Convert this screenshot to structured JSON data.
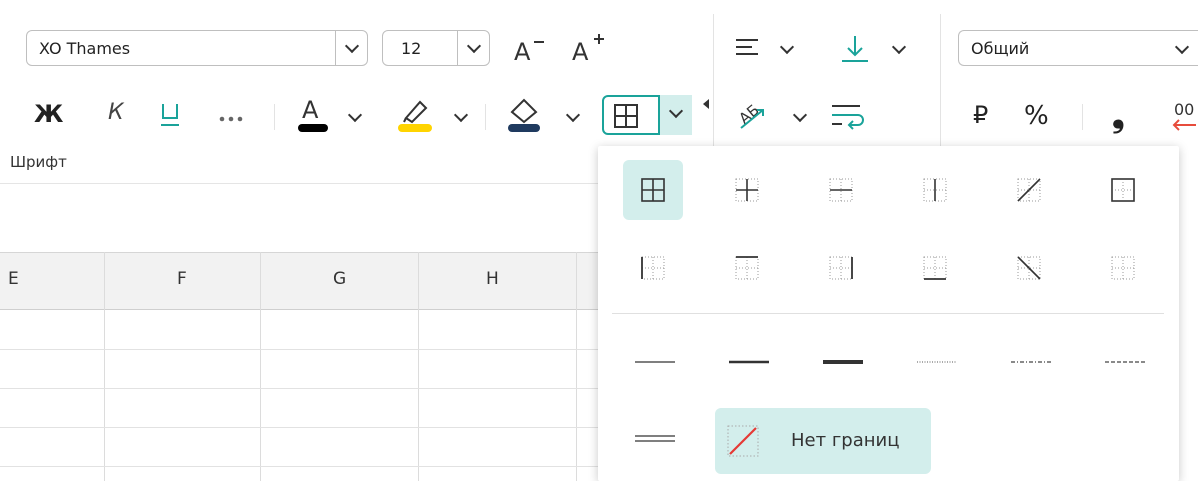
{
  "toolbar": {
    "font_name": "XO Thames",
    "font_size": "12",
    "bold": "Ж",
    "italic": "К",
    "underline": "Ч",
    "more": "...",
    "group_label": "Шрифт",
    "number_format": "Общий",
    "currency": "₽",
    "percent": "%",
    "comma": "❟",
    "font_color": "#000000",
    "highlight_color": "#ffd400",
    "fill_color": "#1f3a5f",
    "accent": "#1aa39a",
    "decrease_decimals": "00"
  },
  "grid": {
    "columns": [
      "E",
      "F",
      "G",
      "H"
    ]
  },
  "border_popup": {
    "no_borders_label": "Нет границ",
    "icons": [
      "all-borders-icon",
      "inside-borders-icon",
      "inside-horizontal-icon",
      "inside-vertical-icon",
      "diagonal-up-icon",
      "outside-borders-icon",
      "left-border-icon",
      "top-border-icon",
      "right-border-icon",
      "bottom-border-icon",
      "diagonal-down-icon",
      "no-inner-borders-icon"
    ],
    "line_styles": [
      "thin",
      "medium",
      "thick",
      "dotted",
      "dash-dot",
      "dashed",
      "double"
    ]
  }
}
